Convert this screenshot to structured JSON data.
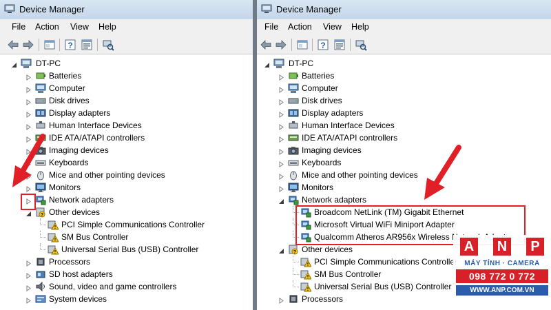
{
  "window": {
    "title": "Device Manager"
  },
  "menu": [
    "File",
    "Action",
    "View",
    "Help"
  ],
  "toolbar_icons": [
    "back-arrow-icon",
    "forward-arrow-icon",
    "show-hide-tree-icon",
    "help-icon",
    "properties-icon",
    "scan-hardware-icon"
  ],
  "root": "DT-PC",
  "left_tree": [
    {
      "label": "Batteries",
      "icon": "battery-icon",
      "expander": "collapsed"
    },
    {
      "label": "Computer",
      "icon": "computer-icon",
      "expander": "collapsed"
    },
    {
      "label": "Disk drives",
      "icon": "disk-drive-icon",
      "expander": "collapsed"
    },
    {
      "label": "Display adapters",
      "icon": "display-adapter-icon",
      "expander": "collapsed"
    },
    {
      "label": "Human Interface Devices",
      "icon": "hid-icon",
      "expander": "collapsed"
    },
    {
      "label": "IDE ATA/ATAPI controllers",
      "icon": "ide-controller-icon",
      "expander": "collapsed"
    },
    {
      "label": "Imaging devices",
      "icon": "camera-icon",
      "expander": "collapsed"
    },
    {
      "label": "Keyboards",
      "icon": "keyboard-icon",
      "expander": "collapsed"
    },
    {
      "label": "Mice and other pointing devices",
      "icon": "mouse-icon",
      "expander": "collapsed"
    },
    {
      "label": "Monitors",
      "icon": "monitor-icon",
      "expander": "collapsed"
    },
    {
      "label": "Network adapters",
      "icon": "network-adapter-icon",
      "expander": "collapsed"
    },
    {
      "label": "Other devices",
      "icon": "other-devices-icon",
      "expander": "expanded"
    },
    {
      "label": "PCI Simple Communications Controller",
      "icon": "warning-device-icon",
      "child": true
    },
    {
      "label": "SM Bus Controller",
      "icon": "warning-device-icon",
      "child": true
    },
    {
      "label": "Universal Serial Bus (USB) Controller",
      "icon": "warning-device-icon",
      "child": true
    },
    {
      "label": "Processors",
      "icon": "processor-icon",
      "expander": "collapsed"
    },
    {
      "label": "SD host adapters",
      "icon": "sd-host-icon",
      "expander": "collapsed"
    },
    {
      "label": "Sound, video and game controllers",
      "icon": "sound-icon",
      "expander": "collapsed"
    },
    {
      "label": "System devices",
      "icon": "system-devices-icon",
      "expander": "collapsed"
    }
  ],
  "right_tree": [
    {
      "label": "Batteries",
      "icon": "battery-icon",
      "expander": "collapsed"
    },
    {
      "label": "Computer",
      "icon": "computer-icon",
      "expander": "collapsed"
    },
    {
      "label": "Disk drives",
      "icon": "disk-drive-icon",
      "expander": "collapsed"
    },
    {
      "label": "Display adapters",
      "icon": "display-adapter-icon",
      "expander": "collapsed"
    },
    {
      "label": "Human Interface Devices",
      "icon": "hid-icon",
      "expander": "collapsed"
    },
    {
      "label": "IDE ATA/ATAPI controllers",
      "icon": "ide-controller-icon",
      "expander": "collapsed"
    },
    {
      "label": "Imaging devices",
      "icon": "camera-icon",
      "expander": "collapsed"
    },
    {
      "label": "Keyboards",
      "icon": "keyboard-icon",
      "expander": "collapsed"
    },
    {
      "label": "Mice and other pointing devices",
      "icon": "mouse-icon",
      "expander": "collapsed"
    },
    {
      "label": "Monitors",
      "icon": "monitor-icon",
      "expander": "collapsed"
    },
    {
      "label": "Network adapters",
      "icon": "network-adapter-icon",
      "expander": "expanded"
    },
    {
      "label": "Broadcom NetLink (TM) Gigabit Ethernet",
      "icon": "network-adapter-icon",
      "child": true
    },
    {
      "label": "Microsoft Virtual WiFi Miniport Adapter",
      "icon": "network-adapter-icon",
      "child": true
    },
    {
      "label": "Qualcomm Atheros AR956x Wireless Network Adapter",
      "icon": "network-adapter-icon",
      "child": true
    },
    {
      "label": "Other devices",
      "icon": "other-devices-icon",
      "expander": "expanded"
    },
    {
      "label": "PCI Simple Communications Controller",
      "icon": "warning-device-icon",
      "child": true
    },
    {
      "label": "SM Bus Controller",
      "icon": "warning-device-icon",
      "child": true
    },
    {
      "label": "Universal Serial Bus (USB) Controller",
      "icon": "warning-device-icon",
      "child": true
    },
    {
      "label": "Processors",
      "icon": "processor-icon",
      "expander": "collapsed"
    }
  ],
  "watermark": {
    "letters": [
      "A",
      "N",
      "P"
    ],
    "tagline": "MÁY TÍNH · CAMERA",
    "phone": "098 772 0 772",
    "website": "WWW.ANP.COM.VN"
  },
  "colors": {
    "annotation_red": "#e01f26",
    "titlebar": "#d3e2f1",
    "brand_red": "#d72027",
    "brand_blue": "#2a5caa"
  }
}
